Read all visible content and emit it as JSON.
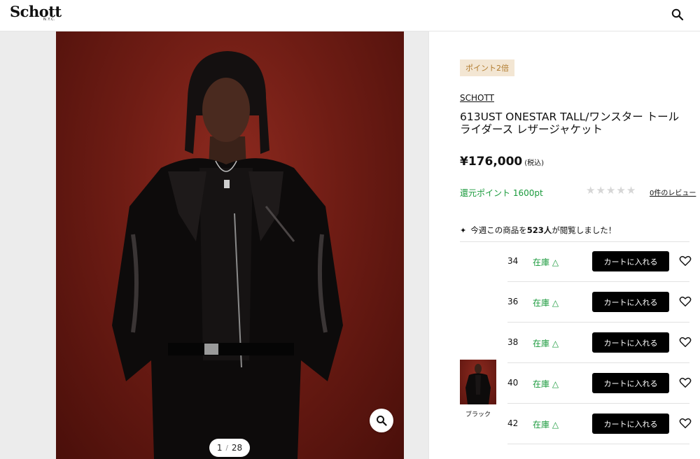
{
  "header": {
    "logo_text": "Schott",
    "logo_sub": "N.Y.C.",
    "search_icon": "search-icon"
  },
  "gallery": {
    "current": "1",
    "separator": "/",
    "total": "28",
    "zoom_icon": "zoom-icon"
  },
  "product": {
    "badge": "ポイント2倍",
    "brand": "SCHOTT",
    "title_line1": "613UST ONESTAR TALL/ワンスター トール",
    "title_line2": "ライダース レザージャケット",
    "price": "¥176,000",
    "tax": "(税込)",
    "points": "還元ポイント 1600pt",
    "rating_stars": 0,
    "review_link": "0件のレビュー",
    "viewed_prefix": "今週この商品を",
    "viewed_count": "523人",
    "viewed_suffix": "が閲覧しました！"
  },
  "variant": {
    "color_name": "ブラック"
  },
  "sizes": [
    {
      "size": "34",
      "stock": "在庫 △",
      "button": "カートに入れる"
    },
    {
      "size": "36",
      "stock": "在庫 △",
      "button": "カートに入れる"
    },
    {
      "size": "38",
      "stock": "在庫 △",
      "button": "カートに入れる"
    },
    {
      "size": "40",
      "stock": "在庫 △",
      "button": "カートに入れる"
    },
    {
      "size": "42",
      "stock": "在庫 △",
      "button": "カートに入れる"
    }
  ],
  "colors": {
    "accent_green": "#1a9a3c",
    "badge_bg": "#f3e6d3",
    "badge_text": "#b07a2c",
    "photo_bg": "#6e1c14"
  }
}
